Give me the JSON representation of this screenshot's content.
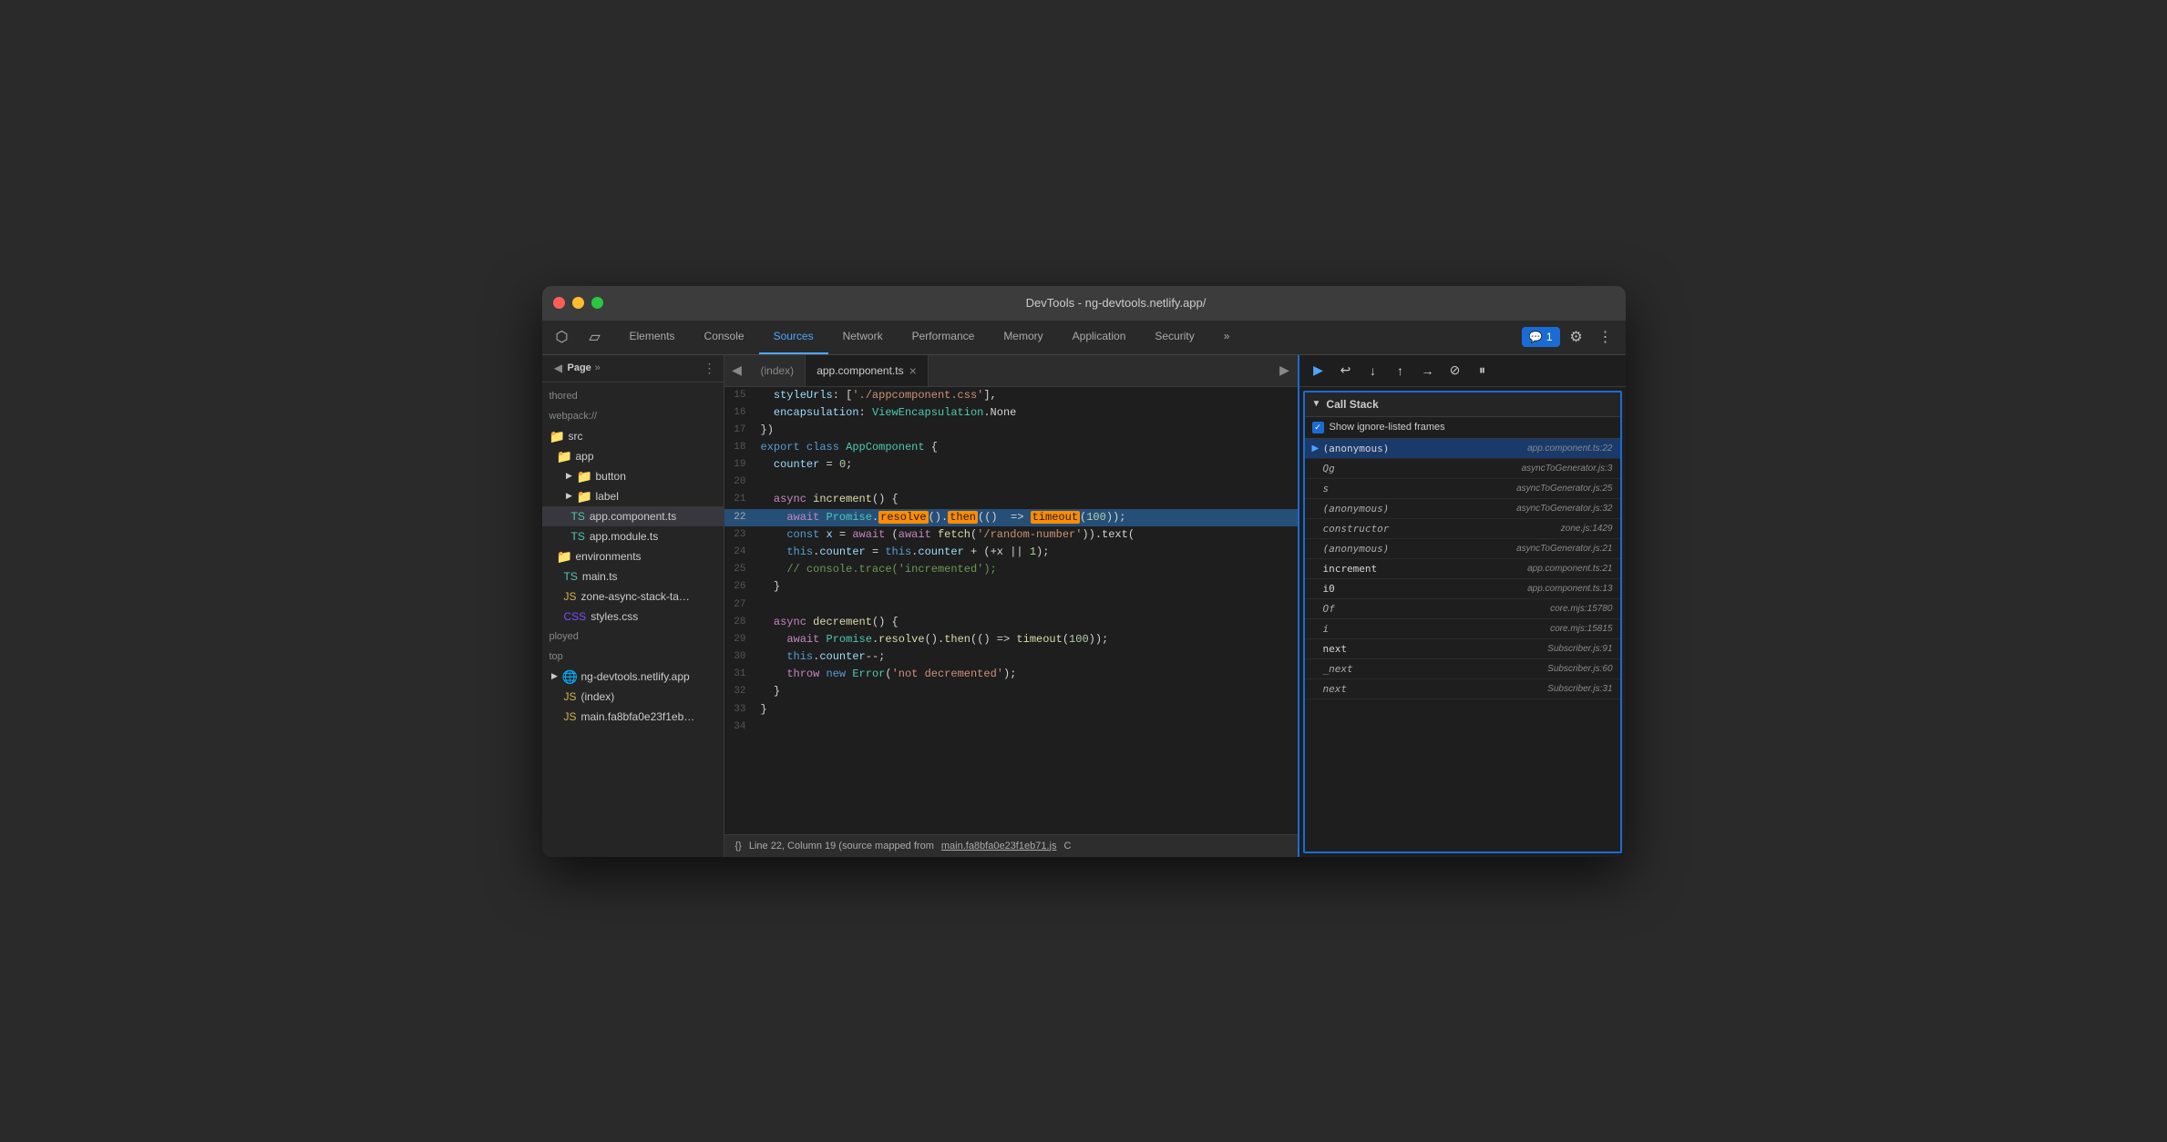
{
  "window": {
    "title": "DevTools - ng-devtools.netlify.app/"
  },
  "traffic_lights": {
    "red": "close",
    "yellow": "minimize",
    "green": "maximize"
  },
  "tabs": [
    {
      "label": "Elements",
      "active": false
    },
    {
      "label": "Console",
      "active": false
    },
    {
      "label": "Sources",
      "active": true
    },
    {
      "label": "Network",
      "active": false
    },
    {
      "label": "Performance",
      "active": false
    },
    {
      "label": "Memory",
      "active": false
    },
    {
      "label": "Application",
      "active": false
    },
    {
      "label": "Security",
      "active": false
    }
  ],
  "badge": {
    "label": "1"
  },
  "sidebar": {
    "title": "Page",
    "items": [
      {
        "label": "thored",
        "type": "text",
        "indent": 0
      },
      {
        "label": "webpack://",
        "type": "text",
        "indent": 0
      },
      {
        "label": "src",
        "type": "folder-orange",
        "indent": 0
      },
      {
        "label": "app",
        "type": "folder-orange",
        "indent": 1
      },
      {
        "label": "button",
        "type": "folder-orange",
        "indent": 2,
        "arrow": true
      },
      {
        "label": "label",
        "type": "folder-orange",
        "indent": 2,
        "arrow": true
      },
      {
        "label": "app.component.ts",
        "type": "file-ts",
        "indent": 2,
        "selected": true
      },
      {
        "label": "app.module.ts",
        "type": "file-ts",
        "indent": 2
      },
      {
        "label": "environments",
        "type": "folder-orange",
        "indent": 1
      },
      {
        "label": "main.ts",
        "type": "file-ts",
        "indent": 1
      },
      {
        "label": "zone-async-stack-ta…",
        "type": "file-js",
        "indent": 1
      },
      {
        "label": "styles.css",
        "type": "file-css",
        "indent": 1
      },
      {
        "label": "ployed",
        "type": "text",
        "indent": 0
      },
      {
        "label": "top",
        "type": "text",
        "indent": 0
      },
      {
        "label": "ng-devtools.netlify.app",
        "type": "folder-purple",
        "indent": 0,
        "arrow": true
      },
      {
        "label": "(index)",
        "type": "file-js",
        "indent": 1
      },
      {
        "label": "main.fa8bfa0e23f1eb…",
        "type": "file-js",
        "indent": 1
      }
    ]
  },
  "editor": {
    "tabs": [
      {
        "label": "(index)",
        "active": false
      },
      {
        "label": "app.component.ts",
        "active": true,
        "closeable": true
      }
    ],
    "lines": [
      {
        "num": 15,
        "content": "  styleUrls: ['./app.component.css'],",
        "highlighted": false
      },
      {
        "num": 16,
        "content": "  encapsulation: ViewEncapsulation.None",
        "highlighted": false
      },
      {
        "num": 17,
        "content": "})",
        "highlighted": false
      },
      {
        "num": 18,
        "content": "export class AppComponent {",
        "highlighted": false
      },
      {
        "num": 19,
        "content": "  counter = 0;",
        "highlighted": false
      },
      {
        "num": 20,
        "content": "",
        "highlighted": false
      },
      {
        "num": 21,
        "content": "  async increment() {",
        "highlighted": false
      },
      {
        "num": 22,
        "content": "    await Promise.resolve().then(() => timeout(100));",
        "highlighted": true
      },
      {
        "num": 23,
        "content": "    const x = await (await fetch('/random-number')).text(",
        "highlighted": false
      },
      {
        "num": 24,
        "content": "    this.counter = this.counter + (+x || 1);",
        "highlighted": false
      },
      {
        "num": 25,
        "content": "    // console.trace('incremented');",
        "highlighted": false
      },
      {
        "num": 26,
        "content": "  }",
        "highlighted": false
      },
      {
        "num": 27,
        "content": "",
        "highlighted": false
      },
      {
        "num": 28,
        "content": "  async decrement() {",
        "highlighted": false
      },
      {
        "num": 29,
        "content": "    await Promise.resolve().then(() => timeout(100));",
        "highlighted": false
      },
      {
        "num": 30,
        "content": "    this.counter--;",
        "highlighted": false
      },
      {
        "num": 31,
        "content": "    throw new Error('not decremented');",
        "highlighted": false
      },
      {
        "num": 32,
        "content": "  }",
        "highlighted": false
      },
      {
        "num": 33,
        "content": "}",
        "highlighted": false
      },
      {
        "num": 34,
        "content": "",
        "highlighted": false
      }
    ]
  },
  "status_bar": {
    "text": "Line 22, Column 19 (source mapped from",
    "link": "main.fa8bfa0e23f1eb71.js",
    "text2": "C"
  },
  "debugger": {
    "call_stack_title": "Call Stack",
    "ignore_frames_label": "Show ignore-listed frames",
    "frames": [
      {
        "name": "(anonymous)",
        "location": "app.component.ts:22",
        "current": true,
        "italic": false
      },
      {
        "name": "Qg",
        "location": "asyncToGenerator.js:3",
        "current": false,
        "italic": true
      },
      {
        "name": "s",
        "location": "asyncToGenerator.js:25",
        "current": false,
        "italic": true
      },
      {
        "name": "(anonymous)",
        "location": "asyncToGenerator.js:32",
        "current": false,
        "italic": true
      },
      {
        "name": "constructor",
        "location": "zone.js:1429",
        "current": false,
        "italic": true
      },
      {
        "name": "(anonymous)",
        "location": "asyncToGenerator.js:21",
        "current": false,
        "italic": true
      },
      {
        "name": "increment",
        "location": "app.component.ts:21",
        "current": false,
        "italic": false
      },
      {
        "name": "i0",
        "location": "app.component.ts:13",
        "current": false,
        "italic": false
      },
      {
        "name": "Of",
        "location": "core.mjs:15780",
        "current": false,
        "italic": true
      },
      {
        "name": "i",
        "location": "core.mjs:15815",
        "current": false,
        "italic": true
      },
      {
        "name": "next",
        "location": "Subscriber.js:91",
        "current": false,
        "italic": false
      },
      {
        "name": "_next",
        "location": "Subscriber.js:60",
        "current": false,
        "italic": true
      },
      {
        "name": "next",
        "location": "Subscriber.js:31",
        "current": false,
        "italic": true
      }
    ]
  }
}
